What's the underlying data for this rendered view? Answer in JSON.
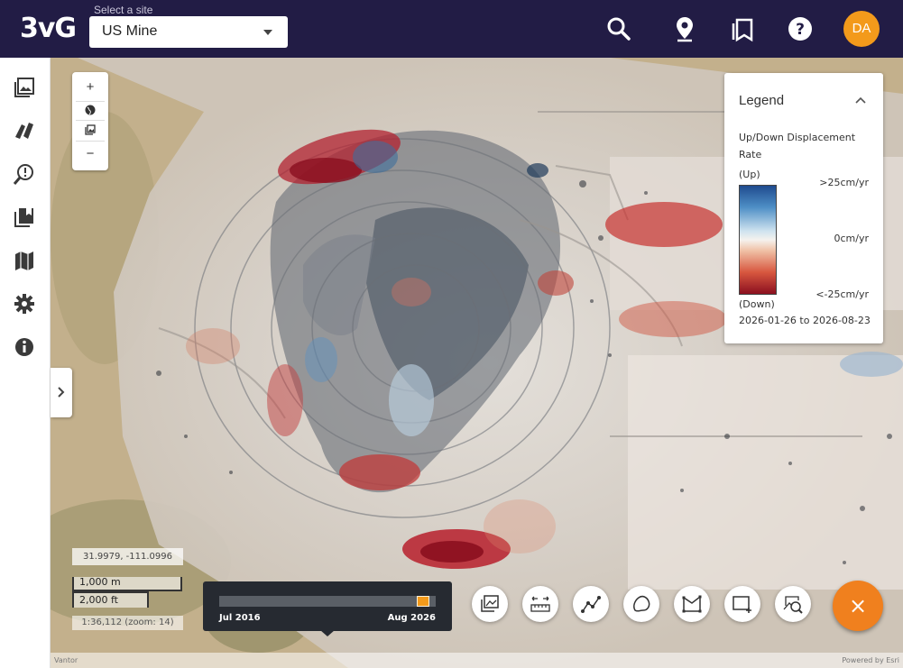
{
  "header": {
    "logo": "3vG",
    "site_label": "Select a site",
    "site_value": "US Mine",
    "icons": [
      "search-icon",
      "location-pin-icon",
      "bookmarks-icon",
      "help-icon"
    ],
    "avatar_initials": "DA",
    "avatar_color": "#f39a1b",
    "background": "#221c45"
  },
  "sidebar": {
    "items": [
      "images-icon",
      "layers-icon",
      "alerts-search-icon",
      "reports-icon",
      "map-icon",
      "settings-icon",
      "info-icon"
    ]
  },
  "zoom_controls": {
    "zoom_in": "+",
    "zoom_out": "−",
    "globe": "globe-icon",
    "basemap": "image-icon"
  },
  "legend": {
    "title": "Legend",
    "subtitle": "Up/Down Displacement Rate",
    "up_label": "(Up)",
    "down_label": "(Down)",
    "max_label": ">25cm/yr",
    "mid_label": "0cm/yr",
    "min_label": "<-25cm/yr",
    "date_range": "2026-01-26 to 2026-08-23"
  },
  "map": {
    "coordinates": "31.9979, -111.0996",
    "scale_metric": "1,000 m",
    "scale_imperial": "2,000 ft",
    "scale_ratio": "1:36,112 (zoom: 14)",
    "attribution_left": "Vantor",
    "attribution_right": "Powered by Esri"
  },
  "timeline": {
    "start_label": "Jul 2016",
    "end_label": "Aug 2026",
    "position_fraction": 0.97,
    "accent": "#f39a1b"
  },
  "tools": [
    "image-compare-icon",
    "measure-distance-icon",
    "polyline-icon",
    "polygon-freehand-icon",
    "area-profile-icon",
    "add-rectangle-icon",
    "image-search-icon"
  ],
  "fab": {
    "label": "×",
    "color": "#f0801e"
  }
}
